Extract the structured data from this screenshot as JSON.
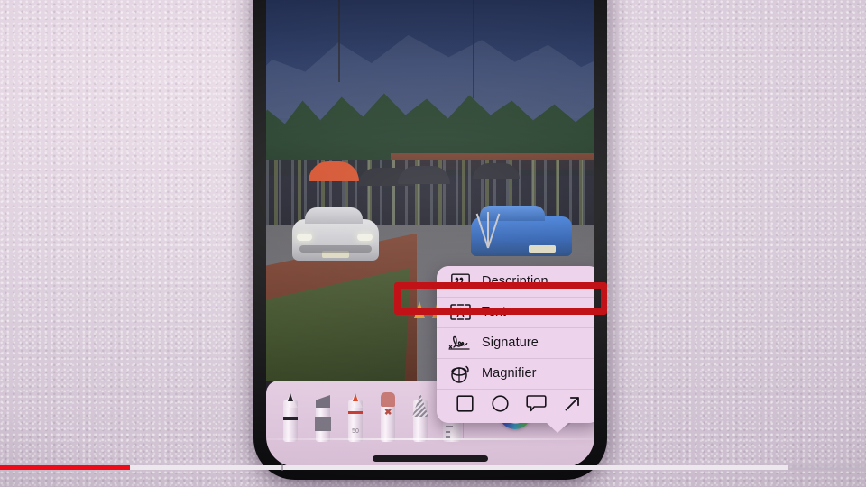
{
  "app": {
    "context": "ios-photos-markup-annotation-tool",
    "device": "smartphone"
  },
  "photo": {
    "description": "Outdoor motorsport event on a road with spectators",
    "subjects": [
      "white BMW hatchback",
      "blue sedan",
      "crowd with umbrellas",
      "orange traffic cones",
      "camera tripod",
      "mountain range",
      "trees"
    ],
    "colors": {
      "sky": "#1c2c58",
      "mountain": "#32416a",
      "trees": "#16331d",
      "road": "#66656b",
      "dirt": "#6a3220",
      "grass": "#32491f",
      "white_car": "#cfcfd4",
      "blue_car": "#2159b4",
      "red_umbrella": "#d8451d",
      "cone": "#f0a621"
    }
  },
  "popup_menu": {
    "items": [
      {
        "label": "Description",
        "icon": "speech-bubble-quote-icon",
        "selected": false
      },
      {
        "label": "Text",
        "icon": "text-box-a-icon",
        "selected": true
      },
      {
        "label": "Signature",
        "icon": "signature-scribble-icon",
        "selected": false
      },
      {
        "label": "Magnifier",
        "icon": "magnifier-loupe-icon",
        "selected": false
      }
    ],
    "shapes": [
      {
        "name": "square-shape-icon",
        "label": "Square"
      },
      {
        "name": "circle-shape-icon",
        "label": "Circle"
      },
      {
        "name": "speech-bubble-shape-icon",
        "label": "Speech Bubble"
      },
      {
        "name": "arrow-shape-icon",
        "label": "Arrow"
      }
    ],
    "background_color": "#edd3ec"
  },
  "annotation": {
    "type": "highlight-rectangle",
    "target": "Text",
    "color": "#c11217",
    "border_width": "7px"
  },
  "toolbar": {
    "background_color": "#dcc3da",
    "tools": [
      {
        "name": "pen-tool",
        "label": "Pen",
        "color": "#1b1b20",
        "size": ""
      },
      {
        "name": "highlighter-tool",
        "label": "Highlighter",
        "color": "#6f6877",
        "size": ""
      },
      {
        "name": "marker-pen-tool",
        "label": "Marker",
        "color": "#c4352c",
        "size": "50"
      },
      {
        "name": "eraser-tool",
        "label": "Eraser",
        "color": "#c4736e",
        "size": ""
      },
      {
        "name": "lasso-tool",
        "label": "Lasso",
        "color": "#8b8492",
        "size": ""
      },
      {
        "name": "ruler-tool",
        "label": "Ruler",
        "color": "#d3c4d3",
        "size": ""
      }
    ],
    "color_picker": {
      "name": "color-picker-button",
      "selected_color": "#cf2a1c"
    },
    "add_button": {
      "name": "add-markup-button",
      "label": "+"
    }
  },
  "video_player": {
    "progress_color": "#ef0a18",
    "buffer_color": "#ece8ee",
    "played_percent": 15,
    "buffered_percent": 91
  }
}
